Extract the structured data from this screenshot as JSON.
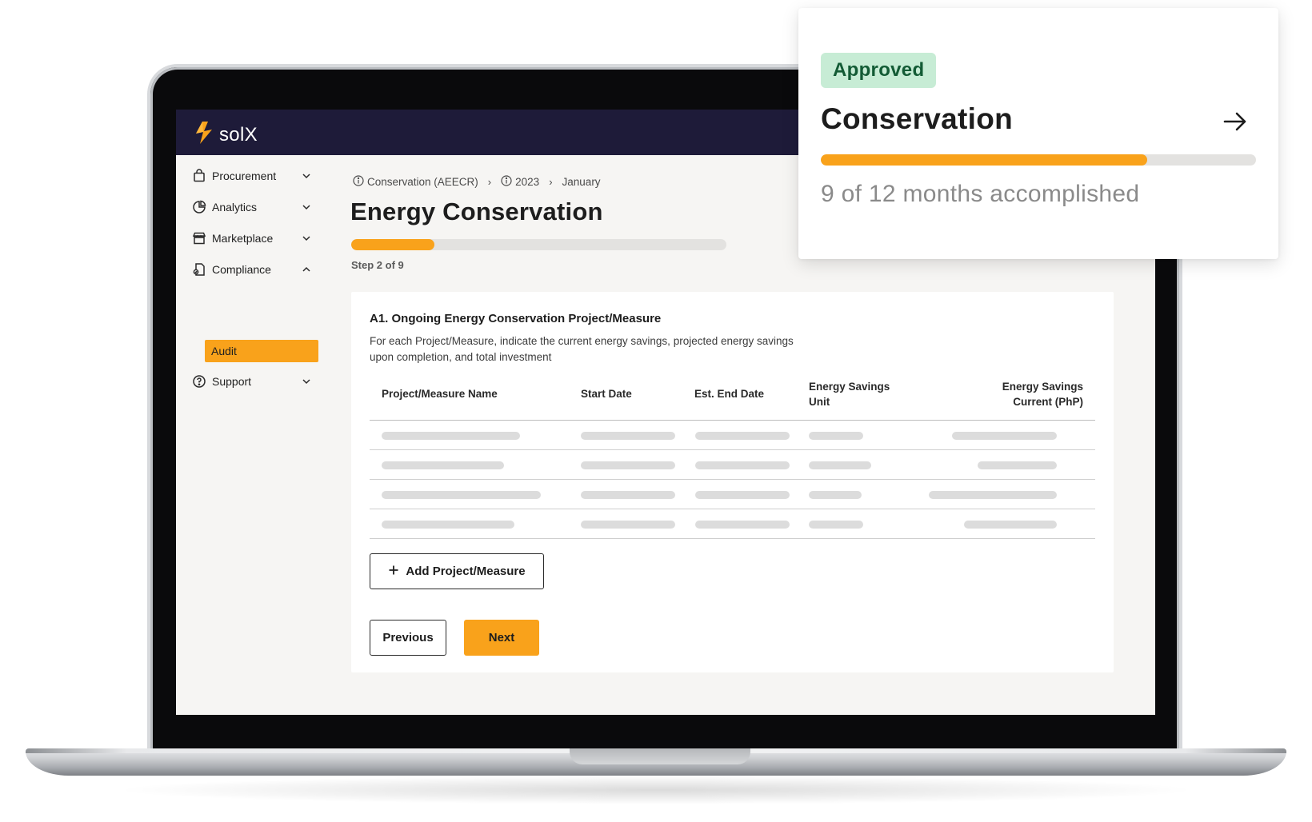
{
  "app": {
    "name": "solX"
  },
  "sidebar": {
    "items": [
      {
        "label": "Procurement",
        "icon": "bag-icon",
        "expanded": false
      },
      {
        "label": "Analytics",
        "icon": "pie-chart-icon",
        "expanded": false
      },
      {
        "label": "Marketplace",
        "icon": "storefront-icon",
        "expanded": false
      },
      {
        "label": "Compliance",
        "icon": "document-icon",
        "expanded": true
      },
      {
        "label": "Support",
        "icon": "help-circle-icon",
        "expanded": false
      }
    ],
    "active_subitem": "Audit"
  },
  "breadcrumb": [
    {
      "label": "Conservation (AEECR)",
      "icon": "info-icon"
    },
    {
      "label": "2023",
      "icon": "info-icon"
    },
    {
      "label": "January"
    }
  ],
  "page": {
    "title": "Energy Conservation",
    "step_label": "Step 2 of 9",
    "step_current": 2,
    "step_total": 9
  },
  "form": {
    "section_title": "A1. Ongoing Energy Conservation Project/Measure",
    "description": "For each Project/Measure, indicate the current energy savings, projected energy savings upon completion, and total investment",
    "columns": [
      {
        "line1": "Project/Measure Name"
      },
      {
        "line1": "Start Date"
      },
      {
        "line1": "Est. End Date"
      },
      {
        "line1": "Energy Savings",
        "line2": "Unit"
      },
      {
        "line1": "Energy Savings",
        "line2": "Current (PhP)"
      }
    ],
    "add_label": "Add Project/Measure",
    "previous_label": "Previous",
    "next_label": "Next"
  },
  "status_card": {
    "badge": "Approved",
    "title": "Conservation",
    "progress_label": "9 of 12 months accomplished",
    "months_done": 9,
    "months_total": 12
  },
  "colors": {
    "accent": "#f9a21b",
    "topbar": "#1e1b39",
    "badge_bg": "#c7ecd5",
    "badge_text": "#135b35"
  }
}
